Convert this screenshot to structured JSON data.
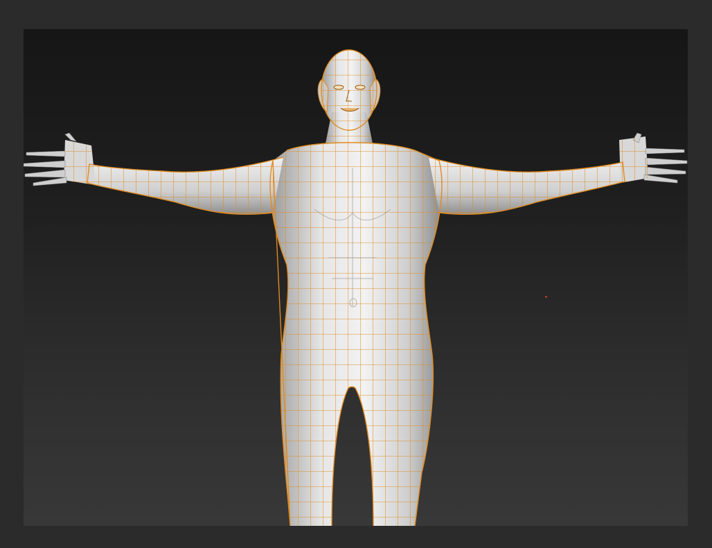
{
  "viewport": {
    "scene": "sculpted-humanoid-with-polygroup-wireframe",
    "colors": {
      "frame": "#2b2b2b",
      "background_top": "#161616",
      "background_bottom": "#383838",
      "skin": "#d9d9d9",
      "skin_shadow": "#8f8f8f",
      "wire": "#e08a1e",
      "stray_dot": "#c0392b"
    }
  }
}
